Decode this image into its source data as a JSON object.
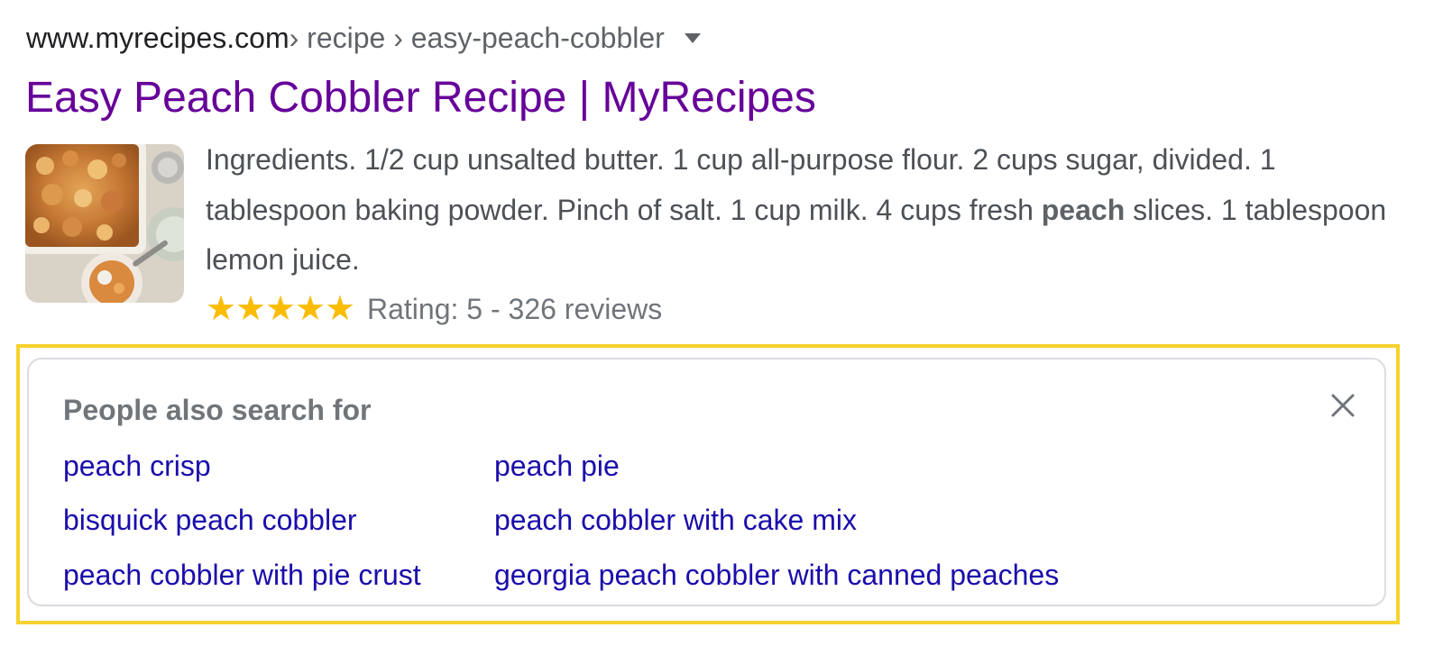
{
  "breadcrumb": {
    "domain": "www.myrecipes.com",
    "path": " › recipe › easy-peach-cobbler",
    "menu_icon": "caret-down-icon"
  },
  "result": {
    "title": "Easy Peach Cobbler Recipe | MyRecipes",
    "thumbnail": "peach-cobbler-photo",
    "snippet_before": "Ingredients. 1/2 cup unsalted butter. 1 cup all-purpose flour. 2 cups sugar, divided. 1 tablespoon baking powder. Pinch of salt. 1 cup milk. 4 cups fresh ",
    "snippet_bold": "peach",
    "snippet_after": " slices. 1 tablespoon lemon juice.",
    "rating_stars": 5,
    "rating_max": 5,
    "rating_text": "Rating: 5 - 326 reviews"
  },
  "people_also_search": {
    "heading": "People also search for",
    "close_icon": "close-icon",
    "links": [
      "peach crisp",
      "peach pie",
      "bisquick peach cobbler",
      "peach cobbler with cake mix",
      "peach cobbler with pie crust",
      "georgia peach cobbler with canned peaches"
    ]
  },
  "colors": {
    "visited_title": "#660099",
    "link": "#1a0dab",
    "star": "#fbbc04",
    "highlight_border": "#f7d22e"
  }
}
